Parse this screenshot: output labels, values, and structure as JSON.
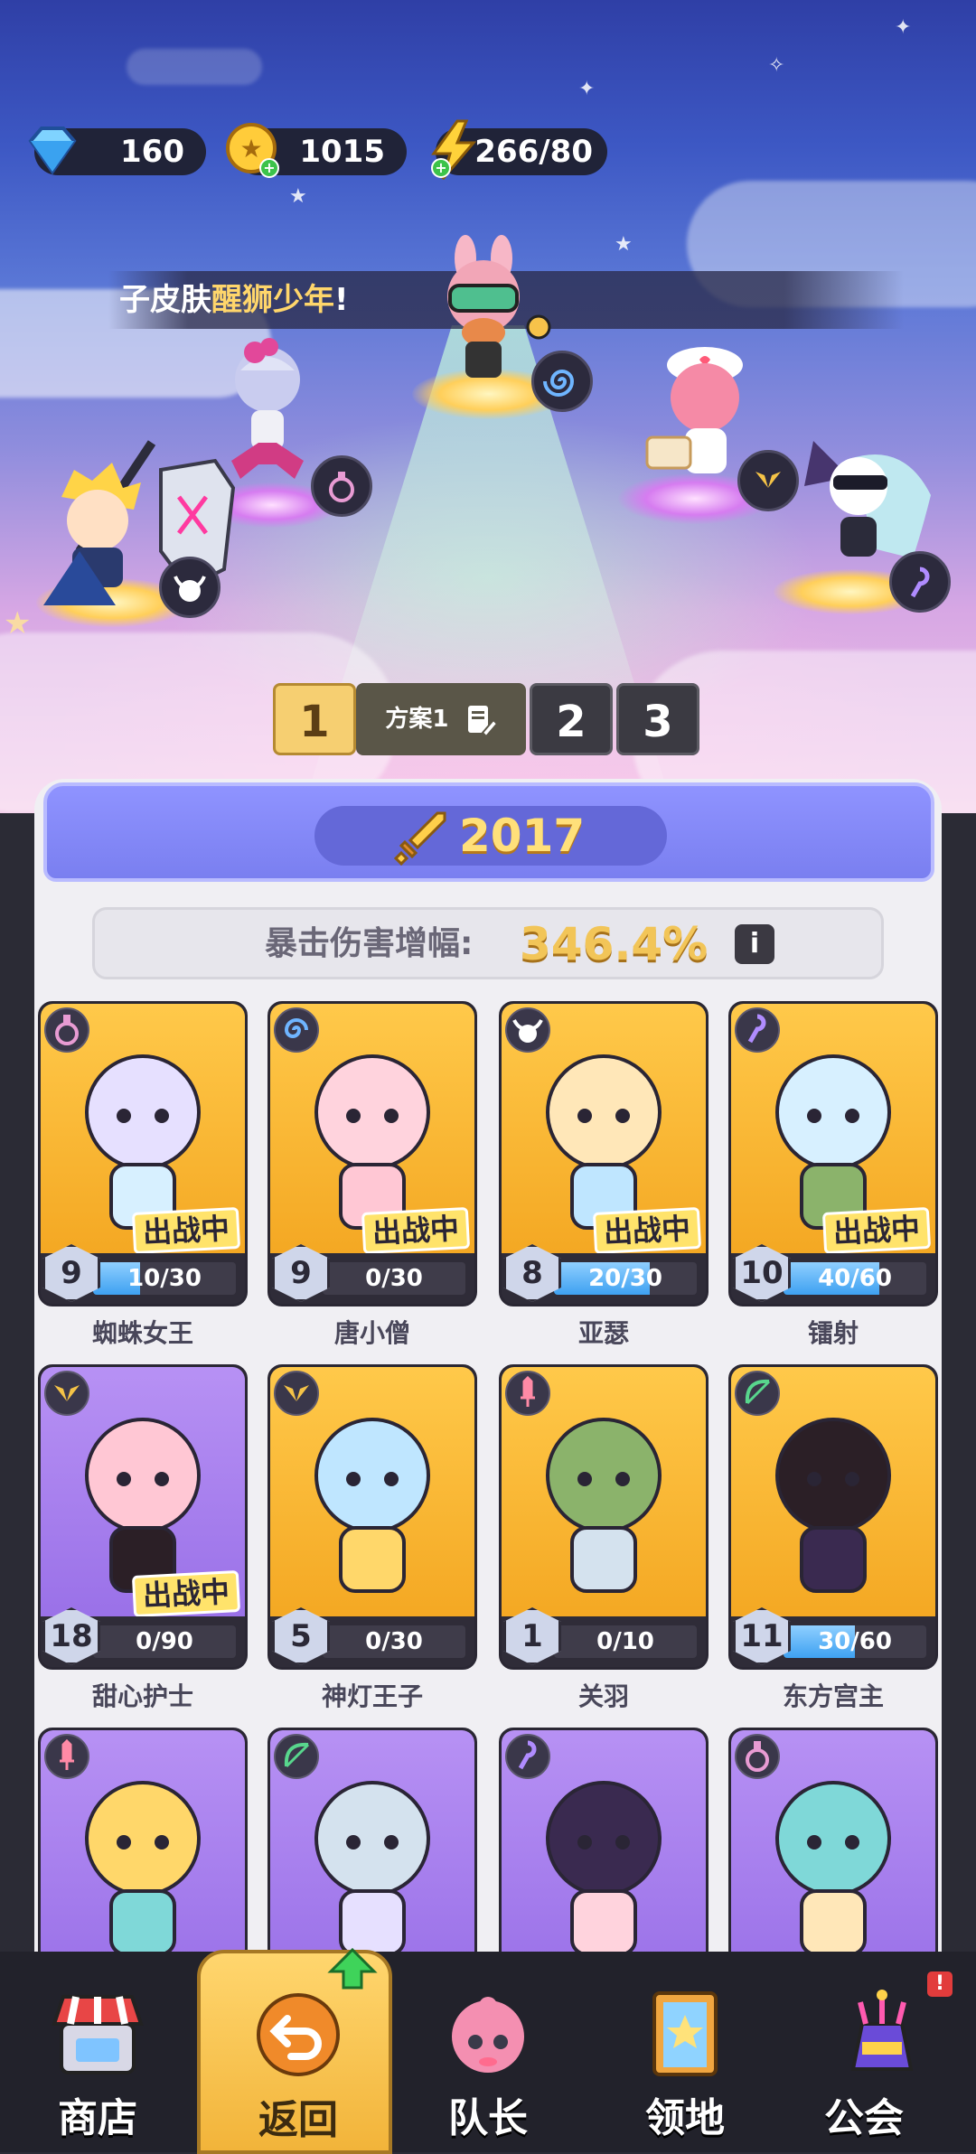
{
  "resources": {
    "gems": "160",
    "coins": "1015",
    "energy": "266/80"
  },
  "banner": {
    "prefix": "子皮肤",
    "highlight": "醒狮少年",
    "suffix": "!"
  },
  "plans": {
    "active_number": "1",
    "active_name": "方案1",
    "option_2": "2",
    "option_3": "3"
  },
  "team": {
    "power": "2017",
    "crit_label": "暴击伤害增幅:",
    "crit_value": "346.4%",
    "info_glyph": "i"
  },
  "heroes": [
    {
      "name": "蜘蛛女王",
      "level": "9",
      "progress": "10/30",
      "fill": 0.33,
      "deployed": true,
      "deploy_label": "出战中",
      "bg": "gold",
      "class_icon": "potion-icon"
    },
    {
      "name": "唐小僧",
      "level": "9",
      "progress": "0/30",
      "fill": 0.0,
      "deployed": true,
      "deploy_label": "出战中",
      "bg": "gold",
      "class_icon": "spiral-icon"
    },
    {
      "name": "亚瑟",
      "level": "8",
      "progress": "20/30",
      "fill": 0.67,
      "deployed": true,
      "deploy_label": "出战中",
      "bg": "gold",
      "class_icon": "bull-icon"
    },
    {
      "name": "镭射",
      "level": "10",
      "progress": "40/60",
      "fill": 0.67,
      "deployed": true,
      "deploy_label": "出战中",
      "bg": "gold",
      "class_icon": "staff-icon"
    },
    {
      "name": "甜心护士",
      "level": "18",
      "progress": "0/90",
      "fill": 0.0,
      "deployed": true,
      "deploy_label": "出战中",
      "bg": "purple",
      "class_icon": "wings-icon"
    },
    {
      "name": "神灯王子",
      "level": "5",
      "progress": "0/30",
      "fill": 0.0,
      "deployed": false,
      "deploy_label": "",
      "bg": "gold",
      "class_icon": "wings-icon"
    },
    {
      "name": "关羽",
      "level": "1",
      "progress": "0/10",
      "fill": 0.0,
      "deployed": false,
      "deploy_label": "",
      "bg": "gold",
      "class_icon": "sword-icon"
    },
    {
      "name": "东方宫主",
      "level": "11",
      "progress": "30/60",
      "fill": 0.5,
      "deployed": false,
      "deploy_label": "",
      "bg": "gold",
      "class_icon": "bow-icon"
    },
    {
      "name": "",
      "level": "",
      "progress": "",
      "fill": 0,
      "deployed": false,
      "deploy_label": "",
      "bg": "purple",
      "class_icon": "sword-icon"
    },
    {
      "name": "",
      "level": "",
      "progress": "",
      "fill": 0,
      "deployed": false,
      "deploy_label": "",
      "bg": "purple",
      "class_icon": "bow-icon"
    },
    {
      "name": "",
      "level": "",
      "progress": "",
      "fill": 0,
      "deployed": false,
      "deploy_label": "",
      "bg": "purple",
      "class_icon": "staff-icon"
    },
    {
      "name": "",
      "level": "",
      "progress": "",
      "fill": 0,
      "deployed": false,
      "deploy_label": "",
      "bg": "purple",
      "class_icon": "potion-icon"
    }
  ],
  "nav": {
    "shop": "商店",
    "back": "返回",
    "captain": "队长",
    "territory": "领地",
    "guild": "公会",
    "guild_badge": "!"
  },
  "colors": {
    "accent_gold": "#f6cf71",
    "power_purple": "#7a7ff0",
    "crit_gold": "#f2c558",
    "progress_blue": "#3ea1f1"
  }
}
